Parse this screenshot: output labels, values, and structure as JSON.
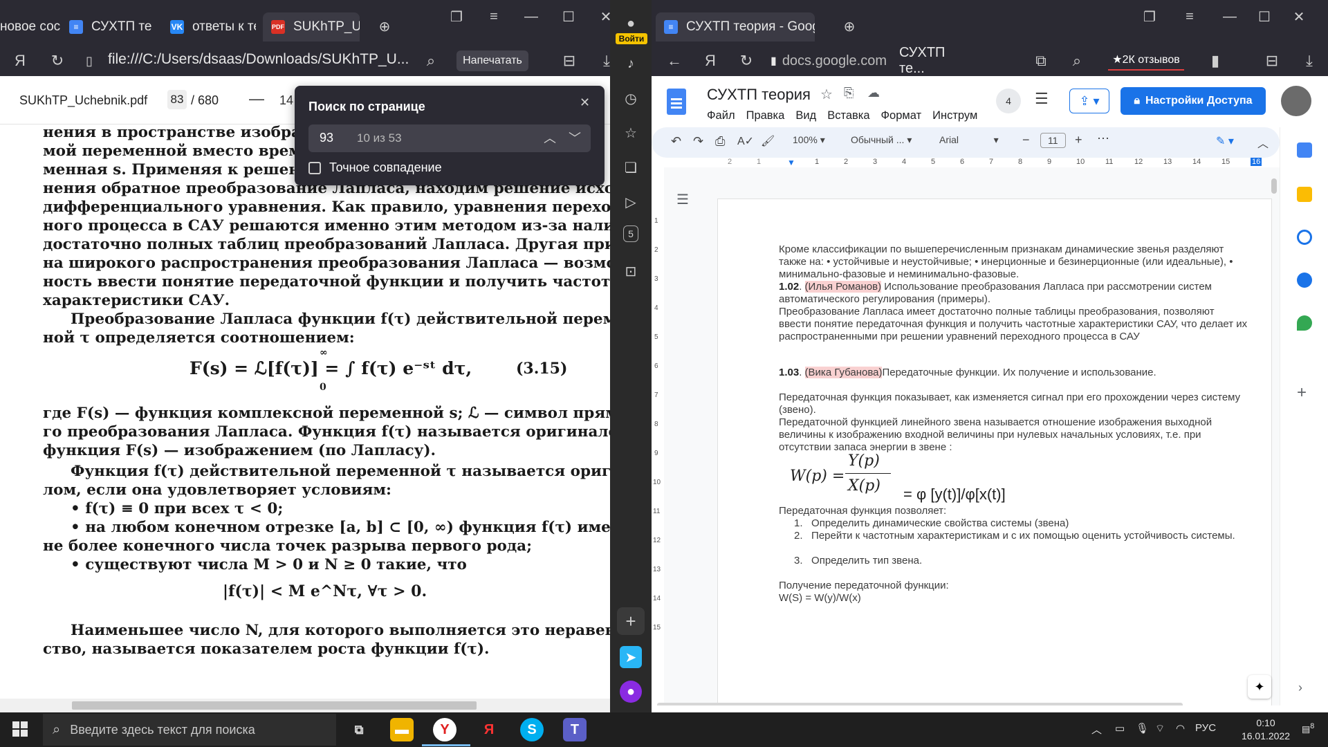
{
  "left_window": {
    "tabs": [
      {
        "label": "новое сос",
        "icon": "tab-page-icon"
      },
      {
        "label": "СУХТП теор",
        "icon": "google-docs-icon"
      },
      {
        "label": "ответы к те",
        "icon": "vk-icon"
      },
      {
        "label": "SUKhTP_U",
        "icon": "pdf-icon"
      }
    ],
    "url": "file:///C:/Users/dsaas/Downloads/SUKhTP_U...",
    "print_label": "Напечатать",
    "pdf": {
      "filename": "SUKhTP_Uchebnik.pdf",
      "current_page": "83",
      "total_pages": "/ 680",
      "zoom_partial": "14"
    },
    "find_panel": {
      "title": "Поиск по странице",
      "query": "93",
      "count": "10 из 53",
      "exact_label": "Точное совпадение"
    },
    "pdf_lines": [
      "нения в пространстве изображени",
      "мой переменной вместо времени",
      "менная s. Применяя к решению д",
      "нения обратное преобразование Лапласа, находим решение исходного",
      "дифференциального уравнения. Как правило, уравнения переход-",
      "ного процесса в САУ решаются именно этим методом из-за наличия",
      "достаточно полных таблиц преобразований Лапласа. Другая причи-",
      "на широкого распространения преобразования Лапласа — возмож-",
      "ность ввести понятие передаточной функции и получить частотные",
      "характеристики САУ.",
      "Преобразование Лапласа функции f(τ) действительной перемен-",
      "ной τ определяется соотношением:",
      "где F(s) — функция комплексной переменной s; ℒ — символ прямо-",
      "го преобразования Лапласа. Функция f(τ) называется оригиналом, а",
      "функция F(s) — изображением (по Лапласу).",
      "Функция f(τ) действительной переменной τ называется оригина-",
      "лом, если она удовлетворяет условиям:",
      "• f(τ) ≡ 0 при всех τ < 0;",
      "• на любом конечном отрезке [a, b] ⊂ [0, ∞) функция f(τ) имеет",
      "не более конечного числа точек разрыва первого рода;",
      "• существуют числа M > 0 и N ≥ 0 такие, что",
      "Наименьшее число N, для которого выполняется это неравен-",
      "ство, называется показателем роста функции f(τ)."
    ],
    "formula_laplace": "F(s) = ℒ[f(τ)] = ∫ f(τ) e⁻ˢᵗ dτ,",
    "formula_num": "(3.15)",
    "formula_int_top": "∞",
    "formula_int_bottom": "0",
    "formula_bound": "|f(τ)| < M e^Nτ, ∀τ > 0."
  },
  "yandex_sidebar": {
    "login_label": "Войти",
    "counter": "5"
  },
  "right_window": {
    "tab_label": "СУХТП теория - Google",
    "domain": "docs.google.com",
    "page_title": "СУХТП те...",
    "reviews": "★2К отзывов",
    "doc": {
      "title": "СУХТП теория",
      "menu": [
        "Файл",
        "Правка",
        "Вид",
        "Вставка",
        "Формат",
        "Инструм"
      ],
      "collab_count": "4",
      "share_label": "Настройки Доступа",
      "toolbar": {
        "zoom": "100%",
        "style": "Обычный ...",
        "font": "Arial",
        "size": "11"
      },
      "ruler_numbers": [
        "2",
        "1",
        "1",
        "2",
        "3",
        "4",
        "5",
        "6",
        "7",
        "8",
        "9",
        "10",
        "11",
        "12",
        "13",
        "14",
        "15",
        "16"
      ],
      "vruler_numbers": [
        "1",
        "2",
        "3",
        "4",
        "5",
        "6",
        "7",
        "8",
        "9",
        "10",
        "11",
        "12",
        "13",
        "14",
        "15"
      ],
      "paragraphs": {
        "p1": "Кроме классификации по вышеперечисленным признакам динамические звенья разделяют также на: • устойчивые и неустойчивые; • инерционные и безинерционные (или идеальные), • минимально-фазовые и неминимально-фазовые.",
        "p2_num": "1.02",
        "p2_name": "(Илья Романов)",
        "p2_text": " Использование преобразования Лапласа при рассмотрении систем автоматического регулирования (примеры).",
        "p3": "Преобразование Лапласа имеет достаточно полные таблицы преобразования, позволяют ввести понятие передаточная функция и получить частотные характеристики САУ, что делает их распространенными при решении уравнений переходного процесса в САУ",
        "p4_num": "1.03",
        "p4_name": "(Вика Губанова)",
        "p4_text": "Передаточные функции. Их получение и использование.",
        "p5": "Передаточная функция показывает, как изменяется сигнал при его прохождении через систему (звено).",
        "p6": "Передаточной функцией линейного звена называется отношение изображения выходной величины к изображению входной величины при нулевых начальных условиях, т.е. при отсутствии запаса энергии в звене :",
        "formula_lhs": "W(p) =",
        "formula_num": "Y(p)",
        "formula_den": "X(p)",
        "formula_rhs": "= φ [y(t)]/φ[x(t)]",
        "p7": "Передаточная функция позволяет:",
        "list": [
          {
            "n": "1.",
            "t": "Определить динамические свойства системы (звена)"
          },
          {
            "n": "2.",
            "t": "Перейти к частотным характеристикам и с их помощью оценить устойчивость системы."
          },
          {
            "n": "3.",
            "t": "Определить тип звена."
          }
        ],
        "p8": "Получение передаточной функции:",
        "p9": "W(S) = W(y)/W(x)"
      }
    }
  },
  "taskbar": {
    "search_placeholder": "Введите здесь текст для поиска",
    "lang": "РУС",
    "time": "0:10",
    "date": "16.01.2022",
    "notif_count": "8"
  }
}
